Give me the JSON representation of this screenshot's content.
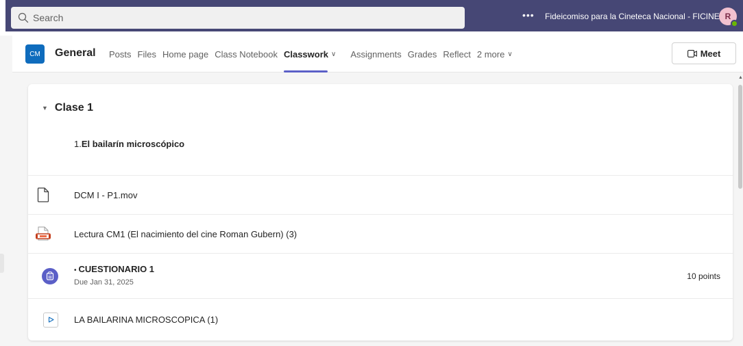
{
  "topbar": {
    "search_placeholder": "Search",
    "more_label": "•••",
    "org_name": "Fideicomiso para la Cineteca Nacional - FICINE",
    "avatar_initial": "R"
  },
  "channel": {
    "team_tile": "CM",
    "title": "General",
    "tabs": [
      {
        "label": "Posts"
      },
      {
        "label": "Files"
      },
      {
        "label": "Home page"
      },
      {
        "label": "Class Notebook"
      },
      {
        "label": "Classwork",
        "chevron": "∨"
      },
      {
        "label": "Assignments"
      },
      {
        "label": "Grades"
      },
      {
        "label": "Reflect"
      },
      {
        "label": "2 more",
        "chevron": "∨"
      }
    ],
    "meet_label": "Meet"
  },
  "classwork": {
    "section_caret": "▼",
    "section_title": "Clase 1",
    "desc_prefix": "1.",
    "desc_bold": "El bailarín microscópico",
    "items": [
      {
        "label": "DCM I - P1.mov",
        "icon": "file-icon"
      },
      {
        "label": "Lectura CM1 (El nacimiento del cine Roman Gubern) (3)",
        "icon": "presentation-icon"
      },
      {
        "bullet": "•",
        "label": "CUESTIONARIO 1",
        "due": "Due Jan 31, 2025",
        "points": "10 points",
        "icon": "assignment-icon"
      },
      {
        "label": "LA BAILARINA MICROSCOPICA (1)",
        "icon": "video-play-icon"
      }
    ]
  },
  "colors": {
    "topbar": "#464775",
    "accent": "#5b5fc7",
    "team_tile": "#0f6cbd"
  }
}
